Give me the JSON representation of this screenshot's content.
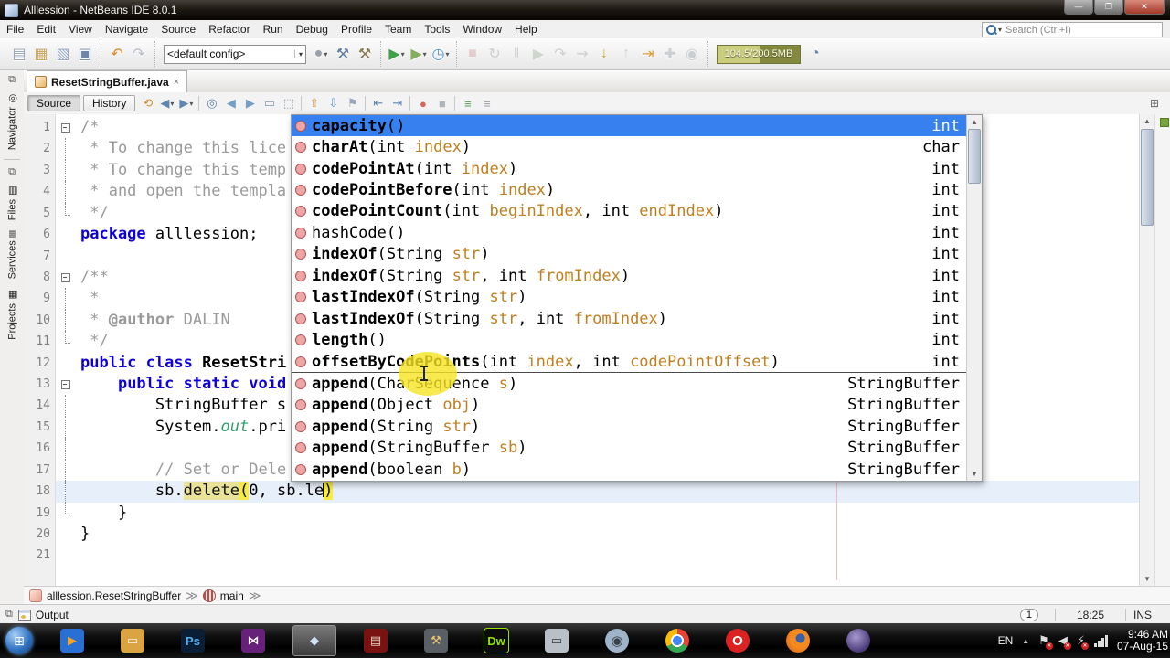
{
  "window": {
    "title": "Alllession - NetBeans IDE 8.0.1",
    "controls": [
      "minimize",
      "restore",
      "close"
    ]
  },
  "menu_bar": {
    "items": [
      "File",
      "Edit",
      "View",
      "Navigate",
      "Source",
      "Refactor",
      "Run",
      "Debug",
      "Profile",
      "Team",
      "Tools",
      "Window",
      "Help"
    ],
    "search_placeholder": "Search (Ctrl+I)"
  },
  "toolbar": {
    "config_value": "<default config>",
    "memory_label": "104.5/200.5MB",
    "groups": [
      [
        {
          "n": "new-file-icon",
          "g": "▤",
          "c": "#8ea0b6"
        },
        {
          "n": "new-project-icon",
          "g": "▦",
          "c": "#c9a255"
        },
        {
          "n": "open-project-icon",
          "g": "▧",
          "c": "#8fa3c2"
        },
        {
          "n": "save-all-icon",
          "g": "▣",
          "c": "#6f86a8"
        }
      ],
      [
        {
          "n": "undo-icon",
          "g": "↶",
          "c": "#e0872a"
        },
        {
          "n": "redo-icon",
          "g": "↷",
          "c": "#b9bec6"
        }
      ],
      [
        {
          "n": "config-select",
          "type": "select"
        },
        {
          "n": "deploy-icon",
          "g": "●",
          "c": "#9aa0a8",
          "arrow": true
        },
        {
          "n": "build-project-icon",
          "g": "⚒",
          "c": "#5f7ea0"
        },
        {
          "n": "clean-build-icon",
          "g": "⚒",
          "c": "#8a7a55"
        }
      ],
      [
        {
          "n": "run-project-icon",
          "g": "▶",
          "c": "#3fa049",
          "arrow": true
        },
        {
          "n": "debug-project-icon",
          "g": "▶",
          "c": "#86ad5e",
          "arrow": true
        },
        {
          "n": "profile-project-icon",
          "g": "◷",
          "c": "#4f94cd",
          "arrow": true
        }
      ],
      [
        {
          "n": "stop-icon",
          "g": "■",
          "c": "#cf9a9a",
          "dis": true
        },
        {
          "n": "reconnect-icon",
          "g": "↻",
          "c": "#9aa0a8",
          "dis": true
        },
        {
          "n": "pause-icon",
          "g": "‖",
          "c": "#9aa0a8",
          "dis": true
        },
        {
          "n": "continue-icon",
          "g": "▶",
          "c": "#9fb29f",
          "dis": true
        },
        {
          "n": "step-over-icon",
          "g": "↷",
          "c": "#9aa0a8",
          "dis": true
        },
        {
          "n": "step-over-expression-icon",
          "g": "⇝",
          "c": "#9aa0a8",
          "dis": true
        },
        {
          "n": "step-into-icon",
          "g": "↓",
          "c": "#dd9c35"
        },
        {
          "n": "step-out-icon",
          "g": "↑",
          "c": "#9aa0a8",
          "dis": true
        },
        {
          "n": "run-to-cursor-icon",
          "g": "⇥",
          "c": "#dd9c35"
        },
        {
          "n": "apply-code-changes-icon",
          "g": "✚",
          "c": "#9aa0a8",
          "dis": true
        },
        {
          "n": "snapshot-camera-icon",
          "g": "◉",
          "c": "#9aa0a8",
          "dis": true
        }
      ],
      [
        {
          "n": "memory-indicator",
          "type": "memory"
        },
        {
          "n": "profiler-vm-icon",
          "g": "◔",
          "c": "#5f86b0"
        }
      ]
    ]
  },
  "sidebar": {
    "dock_glyph": "⧉",
    "items": [
      {
        "label": "Navigator",
        "icon": "compass-icon",
        "g": "◎"
      },
      {
        "label": "Files",
        "icon": "files-icon",
        "g": "▤"
      },
      {
        "label": "Services",
        "icon": "services-icon",
        "g": "≣"
      },
      {
        "label": "Projects",
        "icon": "projects-icon",
        "g": "▦"
      }
    ]
  },
  "editor": {
    "tab_label": "ResetStringBuffer.java",
    "tab_close": "×",
    "toolbar_buttons": [
      {
        "label": "Source",
        "selected": true
      },
      {
        "label": "History",
        "selected": false
      }
    ],
    "toolbar_icons": [
      {
        "n": "last-edit-location-icon",
        "g": "⟲",
        "c": "#d98f2e"
      },
      {
        "n": "back-icon",
        "g": "◀",
        "c": "#5f86b0",
        "arrow": true
      },
      {
        "n": "forward-icon",
        "g": "▶",
        "c": "#5f86b0",
        "arrow": true
      },
      {
        "n": "sep"
      },
      {
        "n": "find-selection-icon",
        "g": "◎",
        "c": "#5f86b0"
      },
      {
        "n": "find-previous-icon",
        "g": "◀",
        "c": "#74a0c8"
      },
      {
        "n": "find-next-icon",
        "g": "▶",
        "c": "#74a0c8"
      },
      {
        "n": "toggle-highlight-icon",
        "g": "▭",
        "c": "#8a9ab0"
      },
      {
        "n": "rectangular-selection-icon",
        "g": "⬚",
        "c": "#8a9ab0"
      },
      {
        "n": "sep"
      },
      {
        "n": "previous-bookmark-icon",
        "g": "⇧",
        "c": "#d98f2e"
      },
      {
        "n": "next-bookmark-icon",
        "g": "⇩",
        "c": "#4f94cd"
      },
      {
        "n": "toggle-bookmark-icon",
        "g": "⚑",
        "c": "#9aa7b8"
      },
      {
        "n": "sep"
      },
      {
        "n": "shift-left-icon",
        "g": "⇤",
        "c": "#5f86b0"
      },
      {
        "n": "shift-right-icon",
        "g": "⇥",
        "c": "#5f86b0"
      },
      {
        "n": "sep"
      },
      {
        "n": "record-macro-icon",
        "g": "●",
        "c": "#d96459"
      },
      {
        "n": "stop-macro-icon",
        "g": "■",
        "c": "#b0b6bd"
      },
      {
        "n": "sep"
      },
      {
        "n": "comment-icon",
        "g": "≡",
        "c": "#55a055"
      },
      {
        "n": "uncomment-icon",
        "g": "≡",
        "c": "#9aa0a8"
      }
    ],
    "split_icon": "⊞",
    "lines": [
      {
        "n": 1,
        "f": "s",
        "segs": [
          [
            "com",
            "/*"
          ]
        ]
      },
      {
        "n": 2,
        "f": "m",
        "segs": [
          [
            "com",
            " * To change this lice"
          ]
        ]
      },
      {
        "n": 3,
        "f": "m",
        "segs": [
          [
            "com",
            " * To change this temp"
          ]
        ]
      },
      {
        "n": 4,
        "f": "m",
        "segs": [
          [
            "com",
            " * and open the templa"
          ]
        ]
      },
      {
        "n": 5,
        "f": "e",
        "segs": [
          [
            "com",
            " */"
          ]
        ]
      },
      {
        "n": 6,
        "segs": [
          [
            "kw",
            "package"
          ],
          [
            "pl",
            " alllession;"
          ]
        ]
      },
      {
        "n": 7,
        "segs": []
      },
      {
        "n": 8,
        "f": "s",
        "segs": [
          [
            "com",
            "/**"
          ]
        ]
      },
      {
        "n": 9,
        "f": "m",
        "segs": [
          [
            "com",
            " *"
          ]
        ]
      },
      {
        "n": 10,
        "f": "m",
        "segs": [
          [
            "com",
            " * "
          ],
          [
            "comb",
            "@author"
          ],
          [
            "com",
            " DALIN"
          ]
        ]
      },
      {
        "n": 11,
        "f": "e",
        "segs": [
          [
            "com",
            " */"
          ]
        ]
      },
      {
        "n": 12,
        "segs": [
          [
            "kw",
            "public class "
          ],
          [
            "cls",
            "ResetStri"
          ]
        ]
      },
      {
        "n": 13,
        "f": "s",
        "segs": [
          [
            "pl",
            "    "
          ],
          [
            "kw",
            "public static void"
          ]
        ]
      },
      {
        "n": 14,
        "f": "m",
        "segs": [
          [
            "pl",
            "        StringBuffer s"
          ]
        ]
      },
      {
        "n": 15,
        "f": "m",
        "segs": [
          [
            "pl",
            "        System."
          ],
          [
            "fld",
            "out"
          ],
          [
            "pl",
            ".pri"
          ]
        ]
      },
      {
        "n": 16,
        "f": "m",
        "segs": []
      },
      {
        "n": 17,
        "f": "m",
        "segs": [
          [
            "pl",
            "        "
          ],
          [
            "com",
            "// Set or Dele"
          ]
        ]
      },
      {
        "n": 18,
        "f": "m",
        "cur": true,
        "segs": [
          [
            "pl",
            "        sb."
          ],
          [
            "occ",
            "delete"
          ],
          [
            "brc",
            "("
          ],
          [
            "pl",
            "0, sb.le"
          ],
          [
            "caret",
            ""
          ],
          [
            "brc",
            ")"
          ]
        ]
      },
      {
        "n": 19,
        "f": "e",
        "segs": [
          [
            "pl",
            "    }"
          ]
        ]
      },
      {
        "n": 20,
        "segs": [
          [
            "pl",
            "}"
          ]
        ]
      },
      {
        "n": 21,
        "segs": []
      }
    ]
  },
  "completion_popup": {
    "items": [
      {
        "name": "capacity",
        "params": [],
        "ret": "int",
        "selected": true
      },
      {
        "name": "charAt",
        "params": [
          [
            "int",
            "index"
          ]
        ],
        "ret": "char"
      },
      {
        "name": "codePointAt",
        "params": [
          [
            "int",
            "index"
          ]
        ],
        "ret": "int"
      },
      {
        "name": "codePointBefore",
        "params": [
          [
            "int",
            "index"
          ]
        ],
        "ret": "int"
      },
      {
        "name": "codePointCount",
        "params": [
          [
            "int",
            "beginIndex"
          ],
          [
            "int",
            "endIndex"
          ]
        ],
        "ret": "int"
      },
      {
        "name": "hashCode",
        "params": [],
        "ret": "int",
        "plain": true
      },
      {
        "name": "indexOf",
        "params": [
          [
            "String",
            "str"
          ]
        ],
        "ret": "int"
      },
      {
        "name": "indexOf",
        "params": [
          [
            "String",
            "str"
          ],
          [
            "int",
            "fromIndex"
          ]
        ],
        "ret": "int"
      },
      {
        "name": "lastIndexOf",
        "params": [
          [
            "String",
            "str"
          ]
        ],
        "ret": "int"
      },
      {
        "name": "lastIndexOf",
        "params": [
          [
            "String",
            "str"
          ],
          [
            "int",
            "fromIndex"
          ]
        ],
        "ret": "int"
      },
      {
        "name": "length",
        "params": [],
        "ret": "int"
      },
      {
        "name": "offsetByCodePoints",
        "params": [
          [
            "int",
            "index"
          ],
          [
            "int",
            "codePointOffset"
          ]
        ],
        "ret": "int",
        "separator_after": true
      },
      {
        "name": "append",
        "params": [
          [
            "CharSequence",
            "s"
          ]
        ],
        "ret": "StringBuffer"
      },
      {
        "name": "append",
        "params": [
          [
            "Object",
            "obj"
          ]
        ],
        "ret": "StringBuffer"
      },
      {
        "name": "append",
        "params": [
          [
            "String",
            "str"
          ]
        ],
        "ret": "StringBuffer"
      },
      {
        "name": "append",
        "params": [
          [
            "StringBuffer",
            "sb"
          ]
        ],
        "ret": "StringBuffer"
      },
      {
        "name": "append",
        "params": [
          [
            "boolean",
            "b"
          ]
        ],
        "ret": "StringBuffer"
      }
    ]
  },
  "breadcrumb": {
    "items": [
      {
        "label": "alllession.ResetStringBuffer",
        "icon": "class-icon"
      },
      {
        "label": "main",
        "icon": "method-icon"
      }
    ],
    "chevron": "≫"
  },
  "status_bar": {
    "output_label": "Output",
    "notification_count": "1",
    "caret_position": "18:25",
    "insert_mode": "INS"
  },
  "taskbar": {
    "start_glyph": "⊞",
    "apps": [
      {
        "n": "taskbar-mediaplayer-icon",
        "kind": "sq",
        "bg": "#2a6fd4",
        "fg": "#f6a42a",
        "g": "▶"
      },
      {
        "n": "taskbar-explorer-icon",
        "kind": "sq",
        "bg": "#d9a441",
        "fg": "#fdf6e3",
        "g": "▭"
      },
      {
        "n": "taskbar-photoshop-icon",
        "kind": "sq",
        "bg": "#0a1e36",
        "fg": "#56b0f0",
        "g": "Ps"
      },
      {
        "n": "taskbar-visualstudio-icon",
        "kind": "sq",
        "bg": "#68217a",
        "fg": "#fff",
        "g": "⋈"
      },
      {
        "n": "taskbar-netbeans-icon",
        "kind": "sq",
        "bg": "transparent",
        "fg": "#cfe2f4",
        "g": "◆",
        "active": true
      },
      {
        "n": "taskbar-dictionary-icon",
        "kind": "sq",
        "bg": "#7a1212",
        "fg": "#e8d9c0",
        "g": "▤"
      },
      {
        "n": "taskbar-tools-icon",
        "kind": "sq",
        "bg": "#5a5f66",
        "fg": "#e8c86a",
        "g": "⚒"
      },
      {
        "n": "taskbar-dreamweaver-icon",
        "kind": "sq",
        "bg": "#0c0c0c",
        "fg": "#93e200",
        "g": "Dw",
        "border": "#93e200"
      },
      {
        "n": "taskbar-window-icon",
        "kind": "sq",
        "bg": "#b9bfc7",
        "fg": "#31363d",
        "g": "▭"
      },
      {
        "n": "taskbar-photoviewer-icon",
        "kind": "ci",
        "bg": "#9fb4c8",
        "fg": "#3a3f45",
        "g": "◉"
      },
      {
        "n": "taskbar-chrome-icon",
        "kind": "chrome",
        "g": ""
      },
      {
        "n": "taskbar-opera-icon",
        "kind": "ci",
        "bg": "#dd2222",
        "fg": "#fff",
        "g": "O"
      },
      {
        "n": "taskbar-firefox-icon",
        "kind": "firefox",
        "g": ""
      },
      {
        "n": "taskbar-eclipse-icon",
        "kind": "eclipse",
        "g": ""
      }
    ],
    "tray": {
      "language": "EN",
      "time": "9:46 AM",
      "date": "07-Aug-15"
    }
  }
}
